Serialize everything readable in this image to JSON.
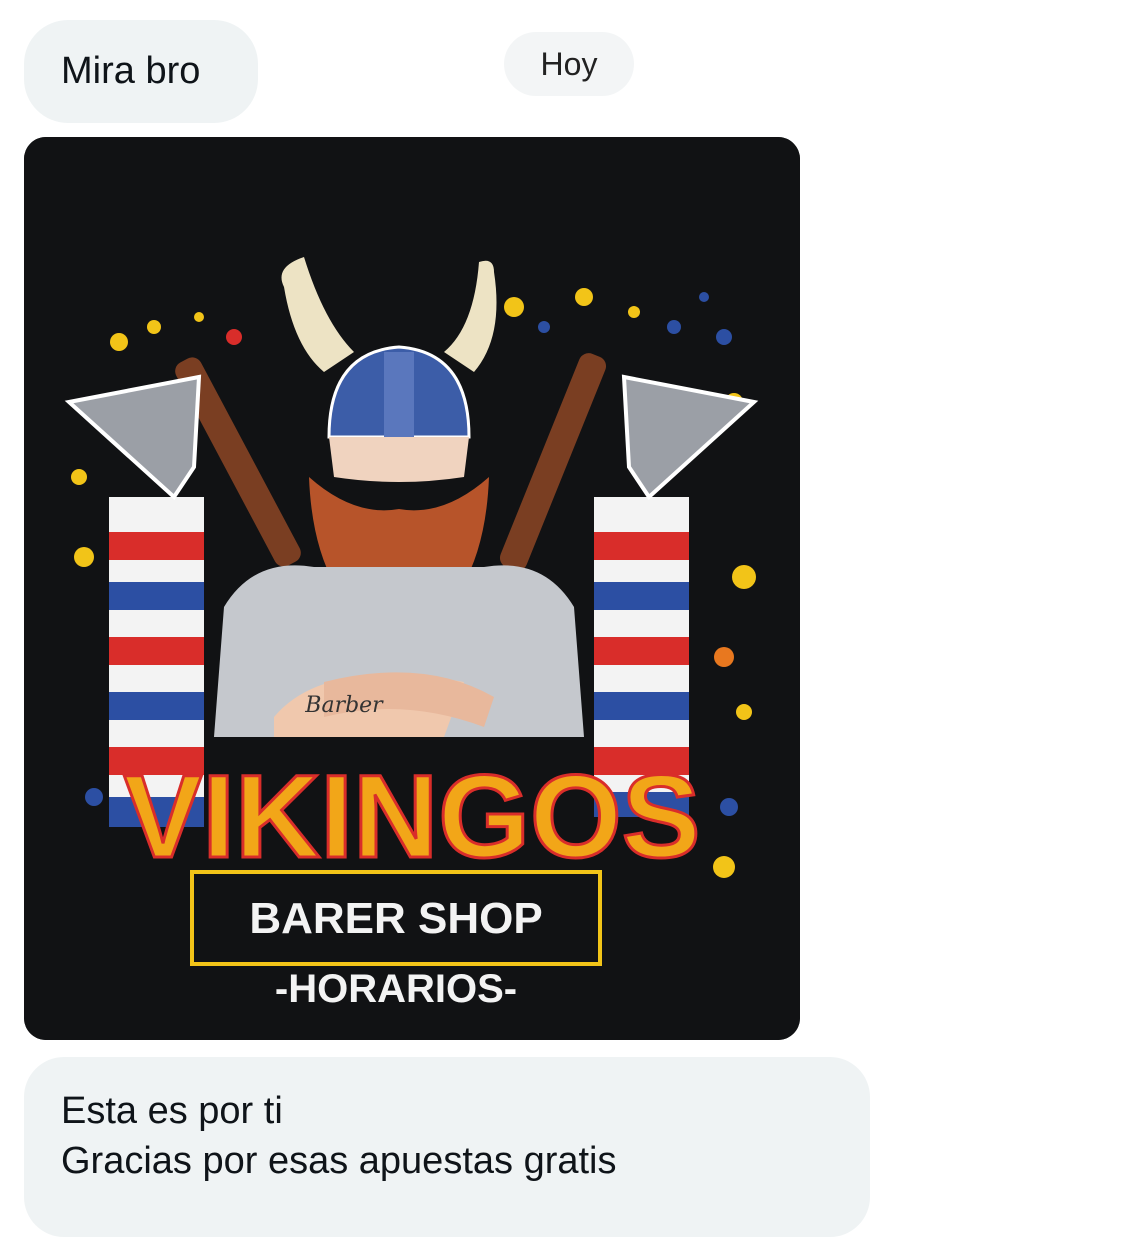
{
  "conversation": {
    "messages": [
      {
        "text": "Mira bro"
      },
      {
        "lines": [
          "Esta es por ti",
          "Gracias por esas apuestas gratis"
        ]
      }
    ],
    "day_separator": "Hoy"
  },
  "attachment": {
    "logo_text": {
      "brand": "VIKINGOS",
      "banner": "BARER SHOP",
      "subtitle": "-HORARIOS-",
      "tattoo": "Barber"
    }
  },
  "colors": {
    "bubble_bg": "#eff3f4",
    "image_bg": "#111214",
    "logo_yellow": "#f2c418",
    "logo_orange": "#e8781f",
    "logo_red": "#d92d2a",
    "logo_blue": "#2c4fa3"
  }
}
